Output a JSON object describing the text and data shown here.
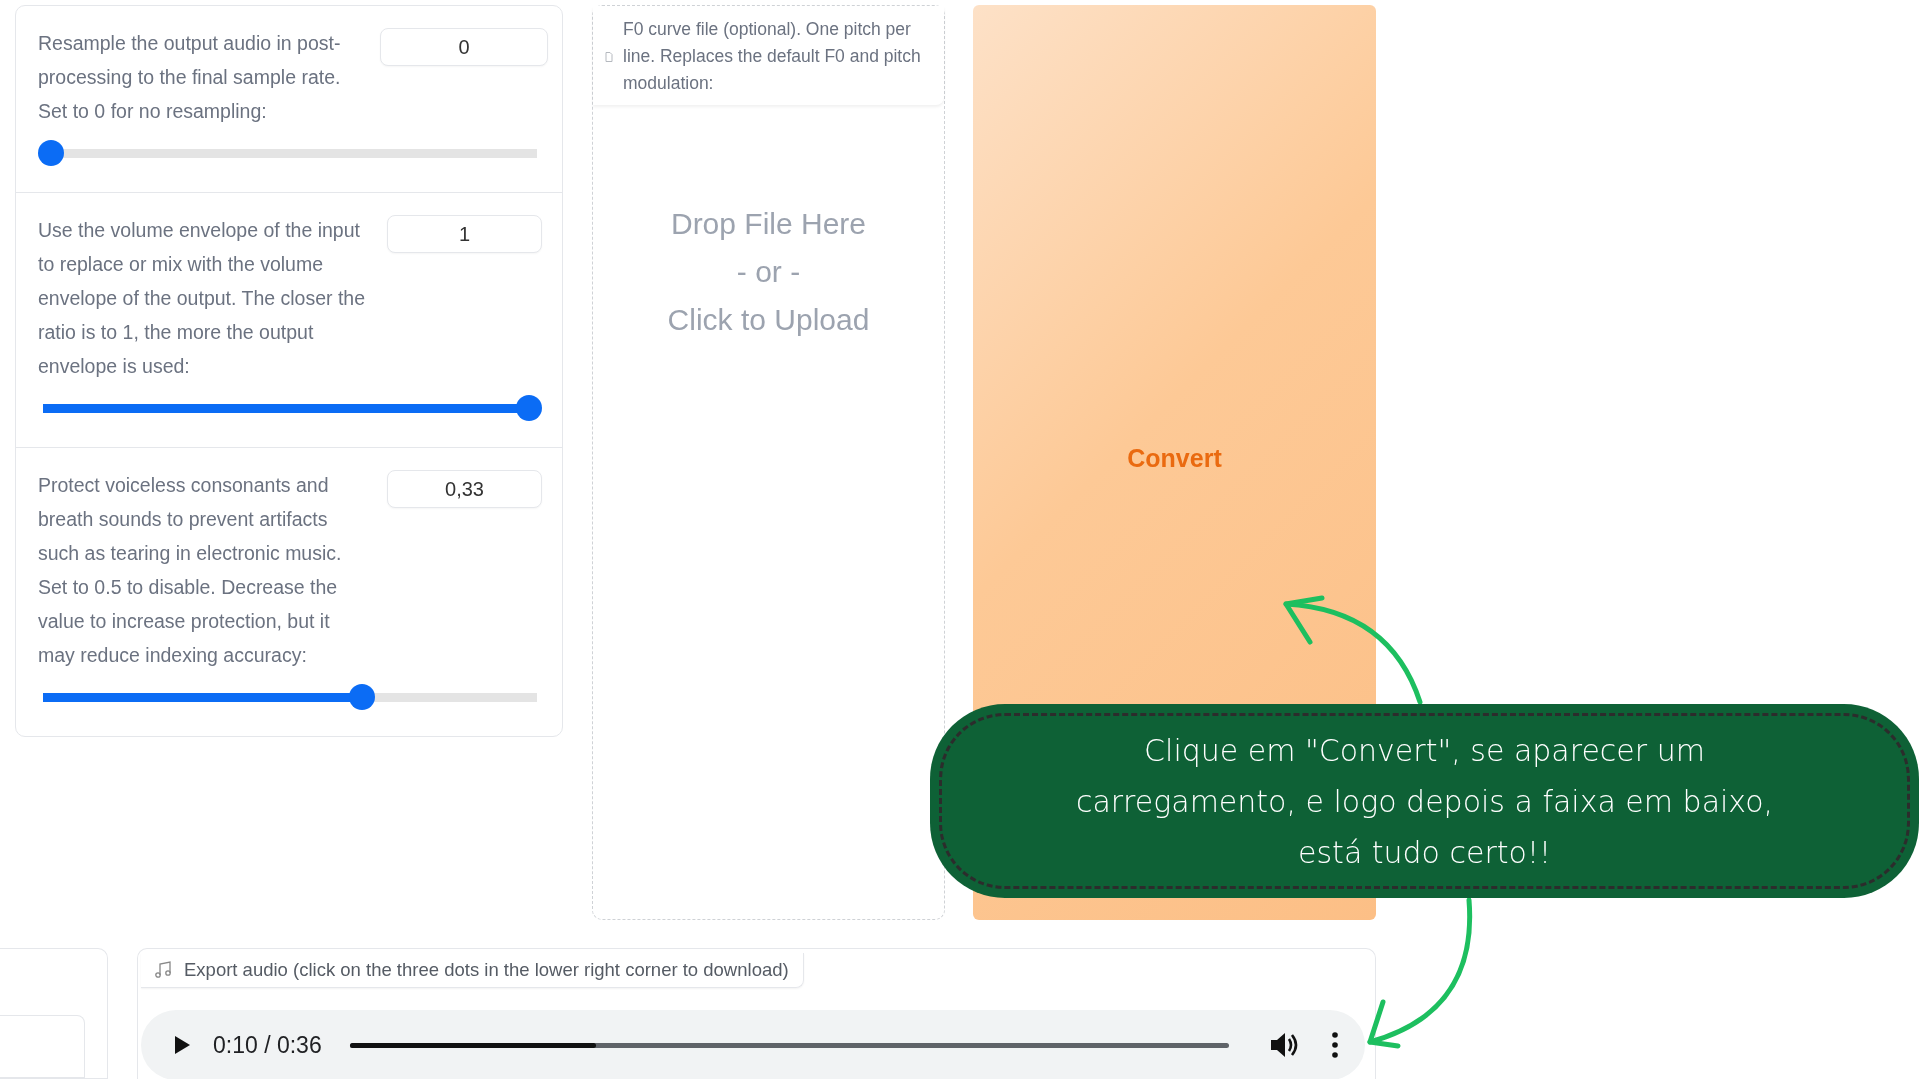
{
  "settings": [
    {
      "label": "Resample the output audio in post-processing to the final sample rate. Set to 0 for no resampling:",
      "value": "0",
      "level": 0
    },
    {
      "label": "Use the volume envelope of the input to replace or mix with the volume envelope of the output. The closer the ratio is to 1, the more the output envelope is used:",
      "value": "1",
      "level": 1
    },
    {
      "label": "Protect voiceless consonants and breath sounds to prevent artifacts such as tearing in electronic music. Set to 0.5 to disable. Decrease the value to increase protection, but it may reduce indexing accuracy:",
      "value": "0,33",
      "level": 0.65
    }
  ],
  "f0_upload": {
    "label": "F0 curve file (optional). One pitch per line. Replaces the default F0 and pitch modulation:",
    "drop_text": [
      "Drop File Here",
      "- or -",
      "Click to Upload"
    ]
  },
  "convert_button": {
    "label": "Convert"
  },
  "export_audio": {
    "label": "Export audio (click on the three dots in the lower right corner to download)",
    "time": "0:10 / 0:36",
    "level": 0.28
  },
  "annotation": {
    "text": "Clique em \"Convert\", se aparecer um carregamento, e logo depois a faixa em baixo, está tudo certo!!"
  }
}
